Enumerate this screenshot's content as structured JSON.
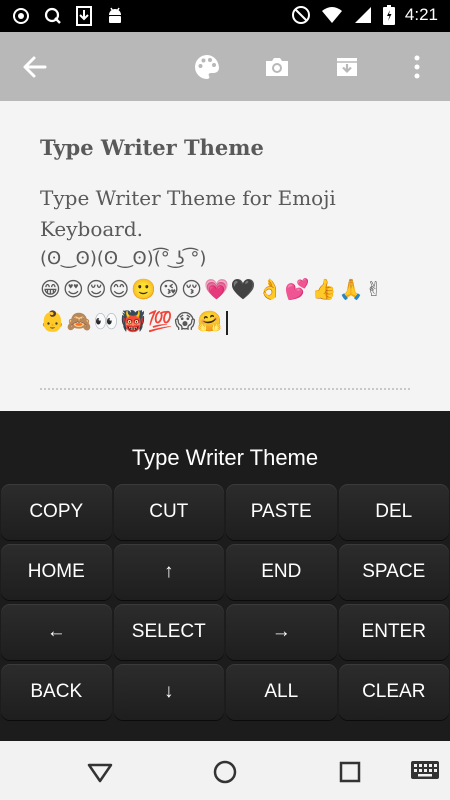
{
  "status_bar": {
    "time": "4:21",
    "left_icons": [
      "camera-circle-icon",
      "q-icon",
      "download-icon",
      "android-icon"
    ],
    "right_icons": [
      "blocked-icon",
      "wifi-icon",
      "signal-icon",
      "battery-icon"
    ]
  },
  "toolbar": {
    "back_icon": "arrow-left-icon",
    "actions": [
      "palette-icon",
      "camera-icon",
      "archive-icon",
      "more-vert-icon"
    ],
    "color": "#b8b8b8"
  },
  "note": {
    "title": "Type Writer Theme",
    "body": "Type Writer Theme  for Emoji Keyboard.",
    "kaomoji": "(ʘ‿ʘ)(ʘ‿ʘ)(͡° ͜ʖ ͡°)",
    "emoji_line1": "😁😍😌😊🙂😘😚💗🖤👌💕👍🙏✌",
    "emoji_line2": "👶🙈👀👹💯😱🤗"
  },
  "keyboard": {
    "title": "Type Writer Theme",
    "keys": [
      "COPY",
      "CUT",
      "PASTE",
      "DEL",
      "HOME",
      "↑",
      "END",
      "SPACE",
      "←",
      "SELECT",
      "→",
      "ENTER",
      "BACK",
      "↓",
      "ALL",
      "CLEAR"
    ],
    "color": "#1c1c1c"
  },
  "nav_bar": {
    "icons": [
      "back-triangle-icon",
      "home-circle-icon",
      "recents-square-icon",
      "keyboard-icon"
    ]
  }
}
